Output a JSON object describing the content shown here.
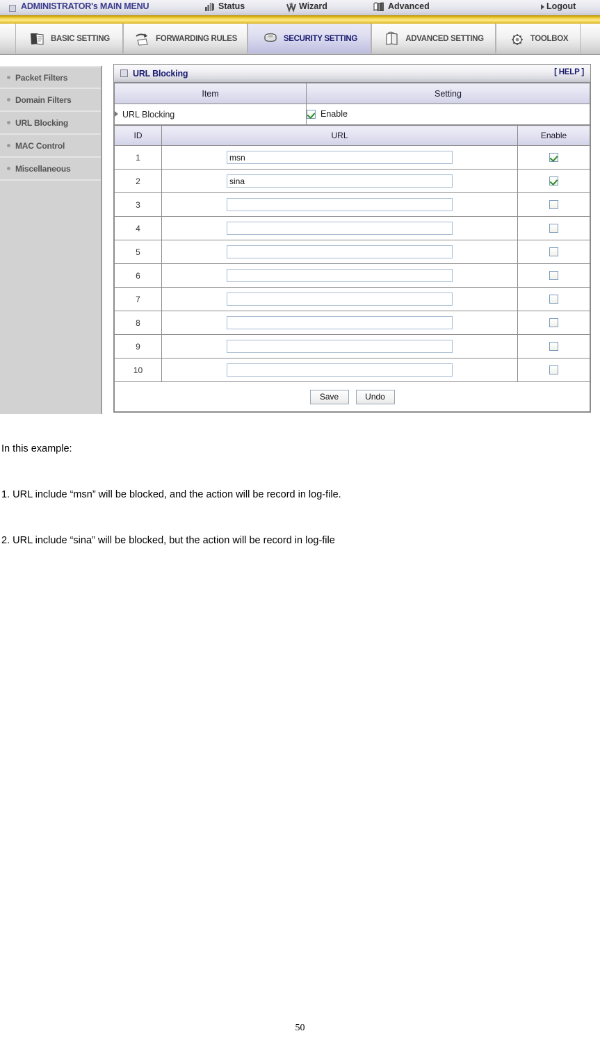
{
  "admin_bar": {
    "square_icon": "window-icon",
    "title": "ADMINISTRATOR's MAIN MENU",
    "items": [
      {
        "label": "Status",
        "icon": "status-icon"
      },
      {
        "label": "Wizard",
        "icon": "wizard-icon"
      },
      {
        "label": "Advanced",
        "icon": "advanced-icon"
      },
      {
        "label": "Logout",
        "icon": "arrow-right-icon"
      }
    ]
  },
  "menu_tabs": [
    {
      "label": "BASIC SETTING",
      "icon": "folder-document-icon",
      "active": false
    },
    {
      "label": "FORWARDING RULES",
      "icon": "arrows-forward-icon",
      "active": false
    },
    {
      "label": "SECURITY SETTING",
      "icon": "shield-stack-icon",
      "active": true
    },
    {
      "label": "ADVANCED SETTING",
      "icon": "books-icon",
      "active": false
    },
    {
      "label": "TOOLBOX",
      "icon": "gear-tools-icon",
      "active": false
    }
  ],
  "sidebar": {
    "items": [
      {
        "label": "Packet Filters"
      },
      {
        "label": "Domain Filters"
      },
      {
        "label": "URL Blocking"
      },
      {
        "label": "MAC Control"
      },
      {
        "label": "Miscellaneous"
      }
    ]
  },
  "panel": {
    "title": "URL Blocking",
    "help_label": "[ HELP ]",
    "columns": {
      "item": "Item",
      "setting": "Setting"
    },
    "enable_row": {
      "item_label": "URL Blocking",
      "setting_label": "Enable",
      "checked": true
    },
    "table_columns": {
      "id": "ID",
      "url": "URL",
      "enable": "Enable"
    },
    "rows": [
      {
        "id": "1",
        "url": "msn",
        "enabled": true
      },
      {
        "id": "2",
        "url": "sina",
        "enabled": true
      },
      {
        "id": "3",
        "url": "",
        "enabled": false
      },
      {
        "id": "4",
        "url": "",
        "enabled": false
      },
      {
        "id": "5",
        "url": "",
        "enabled": false
      },
      {
        "id": "6",
        "url": "",
        "enabled": false
      },
      {
        "id": "7",
        "url": "",
        "enabled": false
      },
      {
        "id": "8",
        "url": "",
        "enabled": false
      },
      {
        "id": "9",
        "url": "",
        "enabled": false
      },
      {
        "id": "10",
        "url": "",
        "enabled": false
      }
    ],
    "buttons": {
      "save": "Save",
      "undo": "Undo"
    }
  },
  "document": {
    "intro": "In this example:",
    "line1": "1. URL include “msn” will be blocked, and the action will be record in log-file.",
    "line2": "2. URL include “sina” will be blocked, but the action will be record in log-file",
    "page_number": "50"
  },
  "colors": {
    "gold_stripe": "#f2d659",
    "title_blue": "#191970",
    "header_lavender": "#e3e3f2",
    "sidebar_gray": "#d2d2d2",
    "check_green": "#2c8b2c"
  }
}
